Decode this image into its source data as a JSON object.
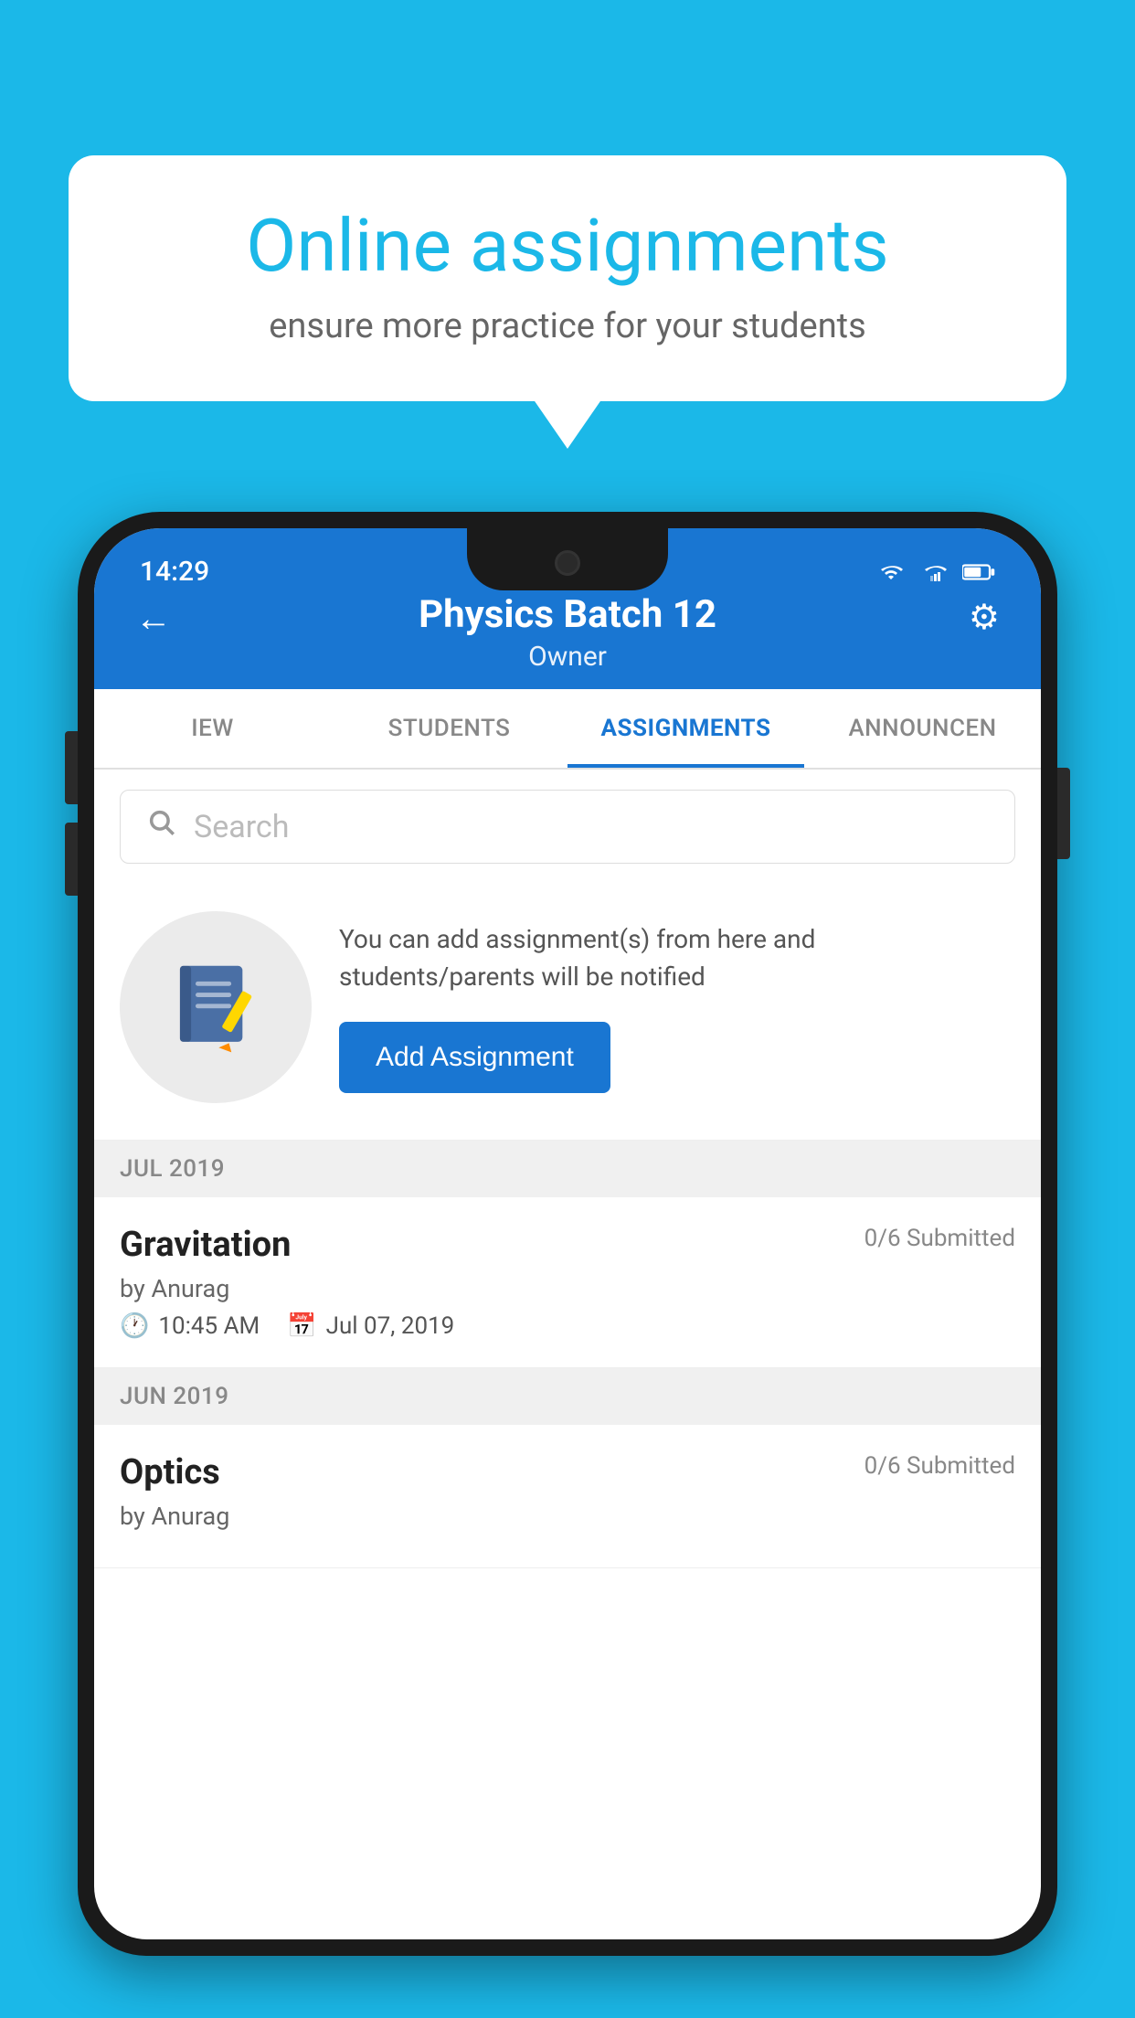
{
  "background": {
    "color": "#1BB8E8"
  },
  "speech_bubble": {
    "title": "Online assignments",
    "subtitle": "ensure more practice for your students"
  },
  "phone": {
    "status_bar": {
      "time": "14:29"
    },
    "header": {
      "title": "Physics Batch 12",
      "subtitle": "Owner",
      "back_label": "←",
      "settings_label": "⚙"
    },
    "tabs": [
      {
        "label": "IEW",
        "active": false
      },
      {
        "label": "STUDENTS",
        "active": false
      },
      {
        "label": "ASSIGNMENTS",
        "active": true
      },
      {
        "label": "ANNOUNCEN",
        "active": false
      }
    ],
    "search": {
      "placeholder": "Search"
    },
    "promo": {
      "description": "You can add assignment(s) from here and students/parents will be notified",
      "button_label": "Add Assignment"
    },
    "sections": [
      {
        "label": "JUL 2019",
        "assignments": [
          {
            "name": "Gravitation",
            "status": "0/6 Submitted",
            "author": "by Anurag",
            "time": "10:45 AM",
            "date": "Jul 07, 2019"
          }
        ]
      },
      {
        "label": "JUN 2019",
        "assignments": [
          {
            "name": "Optics",
            "status": "0/6 Submitted",
            "author": "by Anurag",
            "time": "",
            "date": ""
          }
        ]
      }
    ]
  }
}
